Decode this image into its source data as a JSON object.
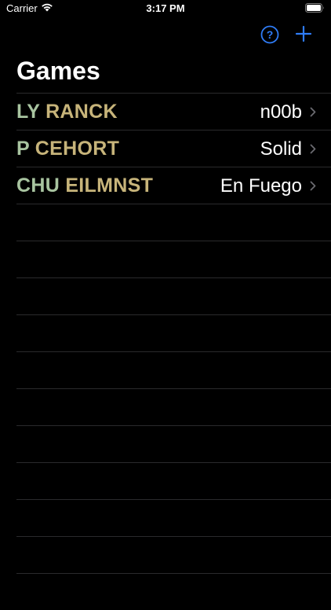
{
  "status_bar": {
    "carrier": "Carrier",
    "time": "3:17 PM",
    "wifi_icon": "wifi-icon",
    "battery_icon": "battery-icon"
  },
  "nav": {
    "help_icon": "question-circle-icon",
    "add_icon": "plus-icon",
    "accent_color": "#2f7cf6"
  },
  "title": "Games",
  "colors": {
    "part1": "#a8c4a0",
    "part2": "#c7b47a",
    "separator": "#2a2a2c"
  },
  "games": [
    {
      "part1": "LY",
      "part2": "RANCK",
      "detail": "n00b"
    },
    {
      "part1": "P",
      "part2": "CEHORT",
      "detail": "Solid"
    },
    {
      "part1": "CHU",
      "part2": "EILMNST",
      "detail": "En Fuego"
    }
  ]
}
